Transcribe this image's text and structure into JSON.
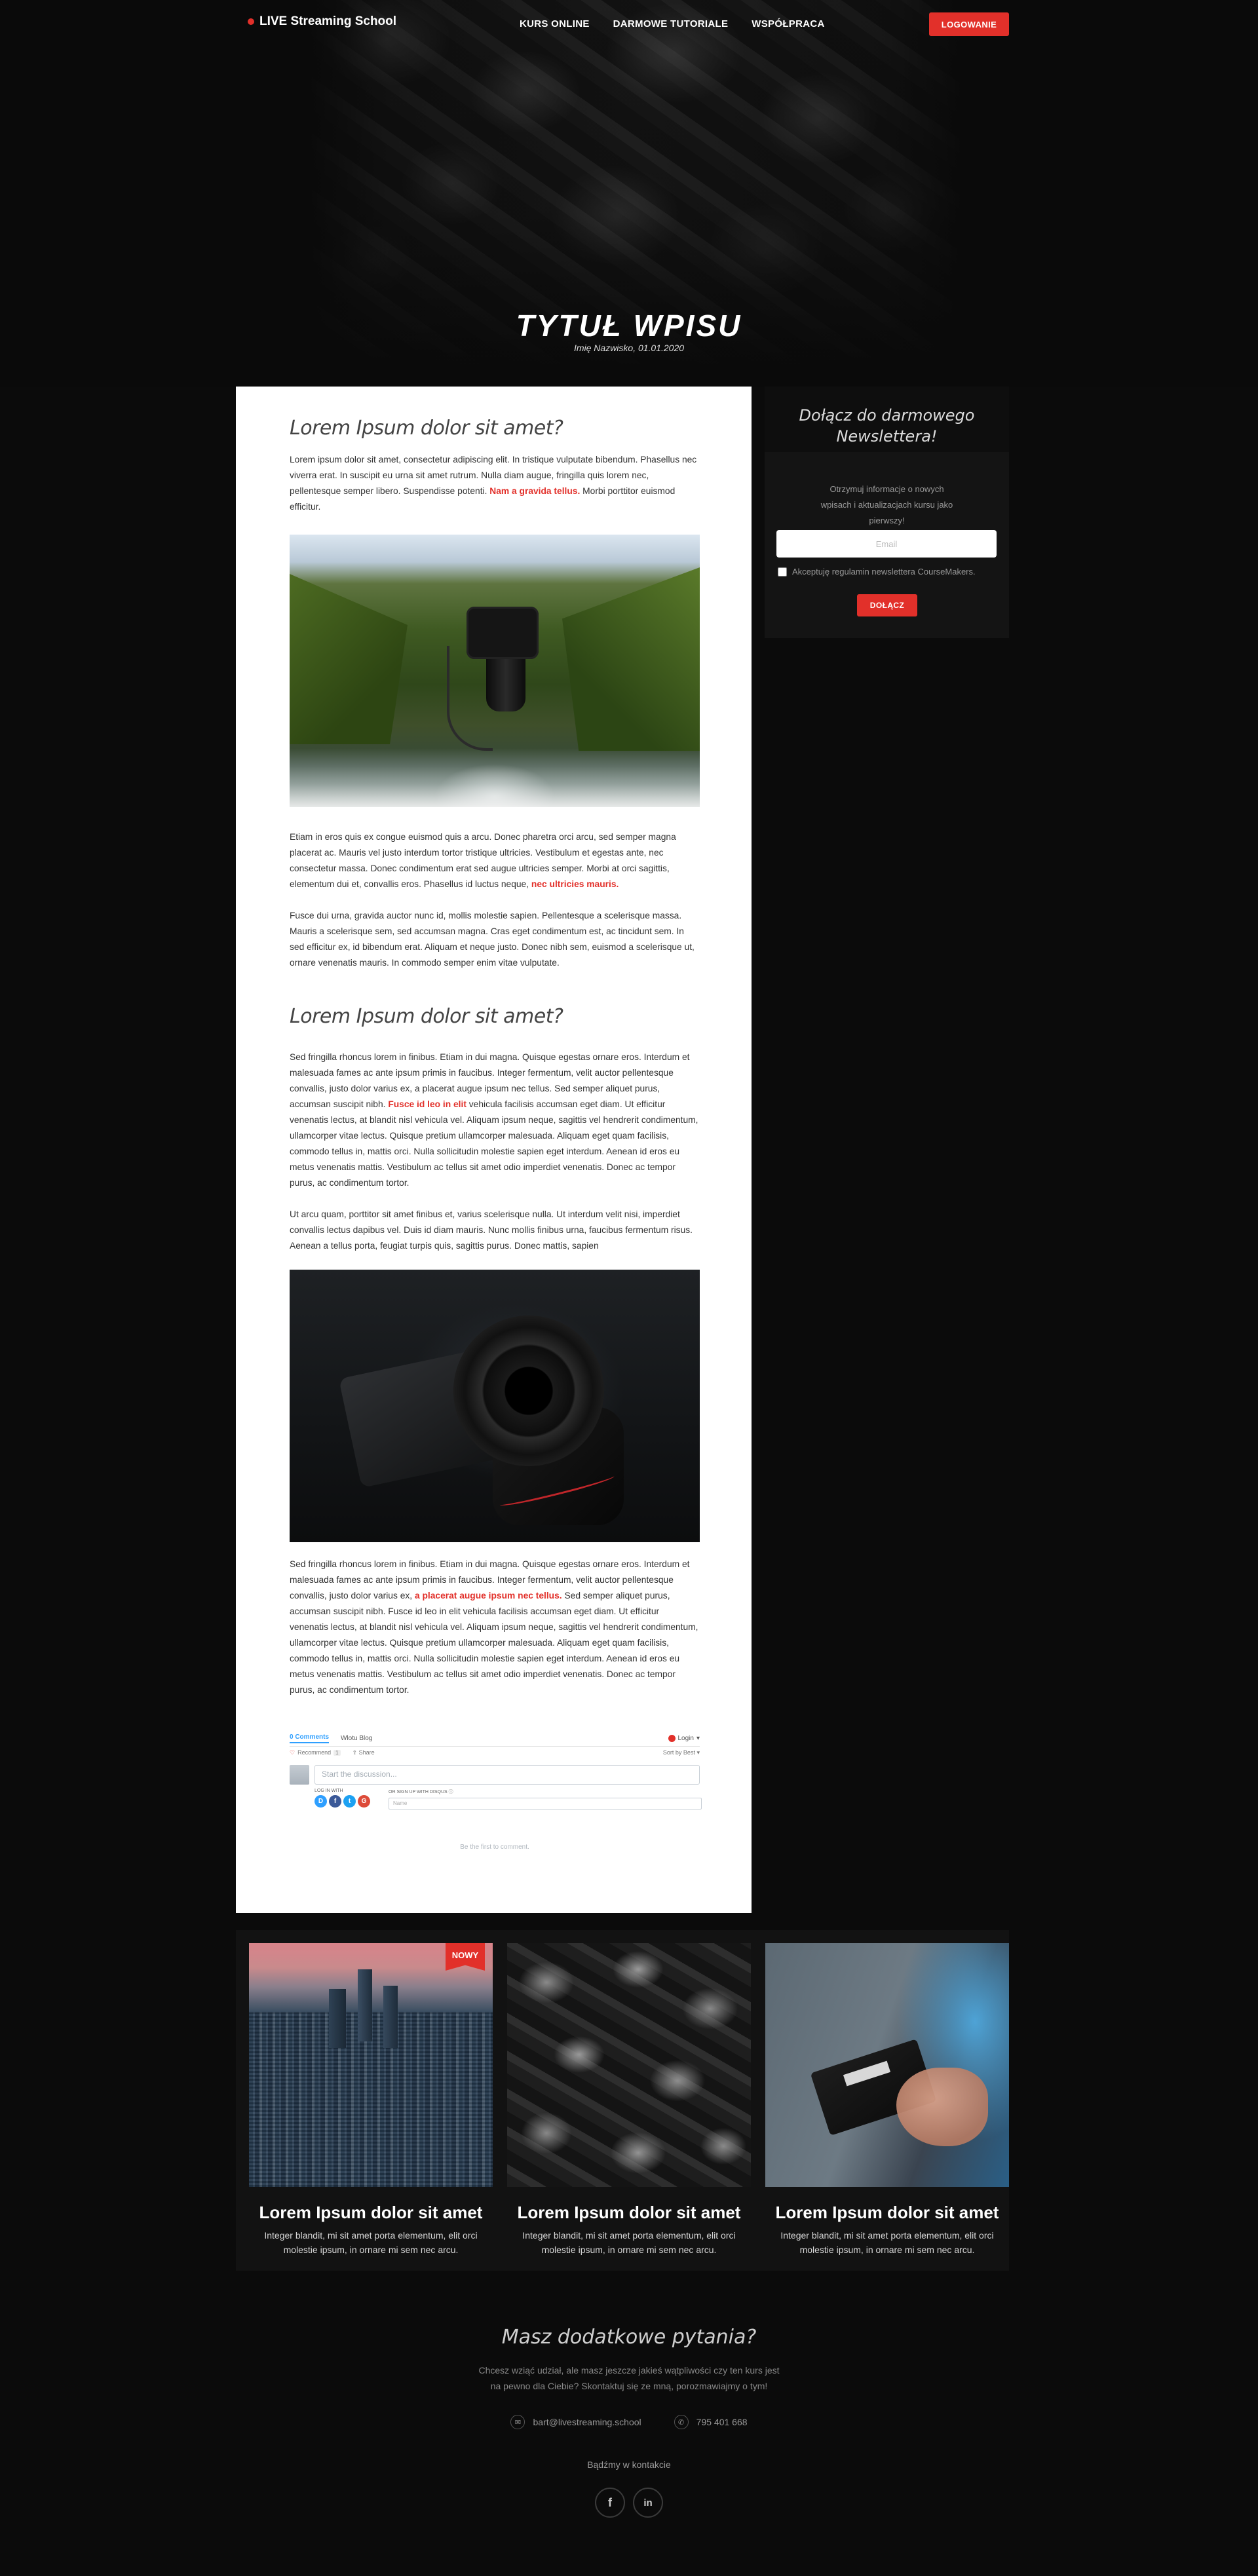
{
  "nav": {
    "logo_text": "LIVE Streaming School",
    "links": [
      "KURS ONLINE",
      "DARMOWE TUTORIALE",
      "WSPÓŁPRACA"
    ],
    "login_label": "LOGOWANIE"
  },
  "hero": {
    "title": "TYTUŁ WPISU",
    "meta": "Imię Nazwisko, 01.01.2020"
  },
  "article": {
    "heading1": "Lorem Ipsum dolor sit amet?",
    "p1": "Lorem ipsum dolor sit amet, consectetur adipiscing elit. In tristique vulputate bibendum. Phasellus nec viverra erat. In suscipit eu urna sit amet rutrum. Nulla diam augue, fringilla quis lorem nec, pellentesque semper libero. Suspendisse potenti.",
    "p1_hl": "Nam a gravida tellus.",
    "p1_end": "Morbi porttitor euismod efficitur.",
    "p2": "Etiam in eros quis ex congue euismod quis a arcu. Donec pharetra orci arcu, sed semper magna placerat ac. Mauris vel justo interdum tortor tristique ultricies. Vestibulum et egestas ante, nec consectetur massa. Donec condimentum erat sed augue ultricies semper. Morbi at orci sagittis, elementum dui et, convallis eros. Phasellus id luctus neque,",
    "p2_hl": "nec ultricies mauris.",
    "p3": "Fusce dui urna, gravida auctor nunc id, mollis molestie sapien. Pellentesque a scelerisque massa. Mauris a scelerisque sem, sed accumsan magna. Cras eget condimentum est, ac tincidunt sem. In sed efficitur ex, id bibendum erat. Aliquam et neque justo. Donec nibh sem, euismod a scelerisque ut, ornare venenatis mauris. In commodo semper enim vitae vulputate.",
    "heading2": "Lorem Ipsum dolor sit amet?",
    "p4": "Sed fringilla rhoncus lorem in finibus. Etiam in dui magna. Quisque egestas ornare eros. Interdum et malesuada fames ac ante ipsum primis in faucibus. Integer fermentum, velit auctor pellentesque convallis, justo dolor varius ex, a placerat augue ipsum nec tellus. Sed semper aliquet purus, accumsan suscipit nibh.",
    "p4_hl": "Fusce id leo in elit",
    "p4_end": "vehicula facilisis accumsan eget diam. Ut efficitur venenatis lectus, at blandit nisl vehicula vel. Aliquam ipsum neque, sagittis vel hendrerit condimentum, ullamcorper vitae lectus. Quisque pretium ullamcorper malesuada. Aliquam eget quam facilisis, commodo tellus in, mattis orci. Nulla sollicitudin molestie sapien eget interdum. Aenean id eros eu metus venenatis mattis. Vestibulum ac tellus sit amet odio imperdiet venenatis. Donec ac tempor purus, ac condimentum tortor.",
    "p5": "Ut arcu quam, porttitor sit amet finibus et, varius scelerisque nulla. Ut interdum velit nisi, imperdiet convallis lectus dapibus vel. Duis id diam mauris. Nunc mollis finibus urna, faucibus fermentum risus. Aenean a tellus porta, feugiat turpis quis, sagittis purus. Donec mattis, sapien",
    "p6": "Sed fringilla rhoncus lorem in finibus. Etiam in dui magna. Quisque egestas ornare eros. Interdum et malesuada fames ac ante ipsum primis in faucibus. Integer fermentum, velit auctor pellentesque convallis, justo dolor varius ex,",
    "p6_hl": "a placerat augue ipsum nec tellus.",
    "p6_end": "Sed semper aliquet purus, accumsan suscipit nibh. Fusce id leo in elit vehicula facilisis accumsan eget diam. Ut efficitur venenatis lectus, at blandit nisl vehicula vel. Aliquam ipsum neque, sagittis vel hendrerit condimentum, ullamcorper vitae lectus. Quisque pretium ullamcorper malesuada. Aliquam eget quam facilisis, commodo tellus in, mattis orci. Nulla sollicitudin molestie sapien eget interdum. Aenean id eros eu metus venenatis mattis. Vestibulum ac tellus sit amet odio imperdiet venenatis. Donec ac tempor purus, ac condimentum tortor."
  },
  "comments": {
    "count_tab": "0 Comments",
    "site_tab": "Wlotu Blog",
    "login": "Login",
    "recommend": "Recommend",
    "recommend_count": "1",
    "share": "Share",
    "sort": "Sort by Best",
    "input_placeholder": "Start the discussion...",
    "login_with": "LOG IN WITH",
    "or_signup": "OR SIGN UP WITH DISQUS",
    "name_placeholder": "Name",
    "empty": "Be the first to comment."
  },
  "newsletter": {
    "title": "Dołącz do darmowego Newslettera!",
    "desc": "Otrzymuj informacje o nowych wpisach i aktualizacjach kursu jako pierwszy!",
    "email_placeholder": "Email",
    "checkbox_label": "Akceptuję regulamin newslettera CourseMakers.",
    "button_label": "DOŁĄCZ"
  },
  "cards": [
    {
      "title": "Lorem Ipsum dolor sit amet",
      "desc": "Integer blandit, mi sit amet porta elementum, elit orci molestie ipsum, in ornare mi sem nec arcu.",
      "badge": "NOWY"
    },
    {
      "title": "Lorem Ipsum dolor sit amet",
      "desc": "Integer blandit, mi sit amet porta elementum, elit orci molestie ipsum, in ornare mi sem nec arcu."
    },
    {
      "title": "Lorem Ipsum dolor sit amet",
      "desc": "Integer blandit, mi sit amet porta elementum, elit orci molestie ipsum, in ornare mi sem nec arcu."
    }
  ],
  "footer": {
    "title": "Masz dodatkowe pytania?",
    "desc_line1": "Chcesz wziąć udział, ale masz jeszcze jakieś wątpliwości czy ten kurs jest",
    "desc_line2": "na pewno dla Ciebie? Skontaktuj się ze mną, porozmawiajmy o tym!",
    "email": "bart@livestreaming.school",
    "phone": "795 401 668",
    "follow": "Bądźmy w kontakcie",
    "social": [
      "facebook-icon",
      "linkedin-icon"
    ]
  },
  "colors": {
    "accent": "#e2302a",
    "background": "#0b0b0b"
  }
}
